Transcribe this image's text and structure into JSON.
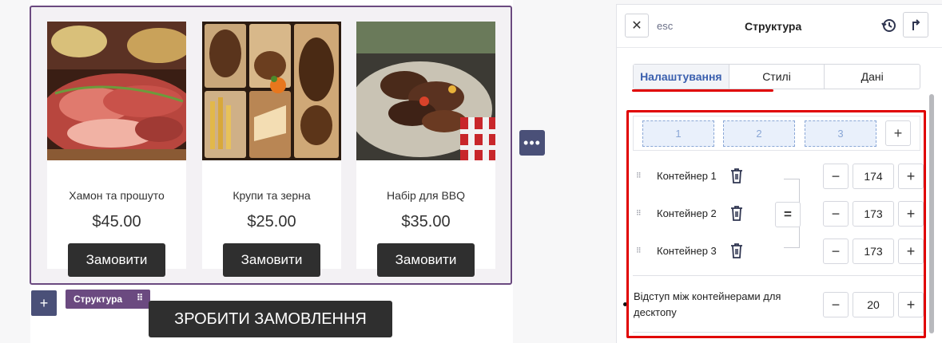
{
  "products": [
    {
      "title": "Хамон та прошуто",
      "price": "$45.00",
      "button": "Замовити",
      "image_icon": "ham-image"
    },
    {
      "title": "Крупи та зерна",
      "price": "$25.00",
      "button": "Замовити",
      "image_icon": "coffee-grains-image"
    },
    {
      "title": "Набір для BBQ",
      "price": "$35.00",
      "button": "Замовити",
      "image_icon": "bbq-image"
    }
  ],
  "canvas": {
    "more_icon": "•••",
    "add_icon": "+",
    "structure_tag": "Структура",
    "drag_icon": "⠿",
    "make_order_button": "ЗРОБИТИ ЗАМОВЛЕННЯ"
  },
  "panel": {
    "close_icon": "✕",
    "esc_label": "esc",
    "title": "Структура",
    "tabs": [
      {
        "label": "Налаштування",
        "active": true
      },
      {
        "label": "Стилі",
        "active": false
      },
      {
        "label": "Дані",
        "active": false
      }
    ],
    "columns": [
      "1",
      "2",
      "3"
    ],
    "add_column_icon": "+",
    "containers": [
      {
        "label": "Контейнер 1",
        "value": "174"
      },
      {
        "label": "Контейнер 2",
        "value": "173"
      },
      {
        "label": "Контейнер 3",
        "value": "173"
      }
    ],
    "equal_icon": "=",
    "minus_icon": "−",
    "plus_icon": "+",
    "gap_label": "Відступ між контейнерами для десктопу",
    "gap_value": "20"
  },
  "colors": {
    "accent": "#6b4a80",
    "button_dark": "#2f2f2f",
    "control_blue": "#4a5078",
    "highlight_red": "#e00000",
    "active_tab_text": "#3a5fae"
  }
}
